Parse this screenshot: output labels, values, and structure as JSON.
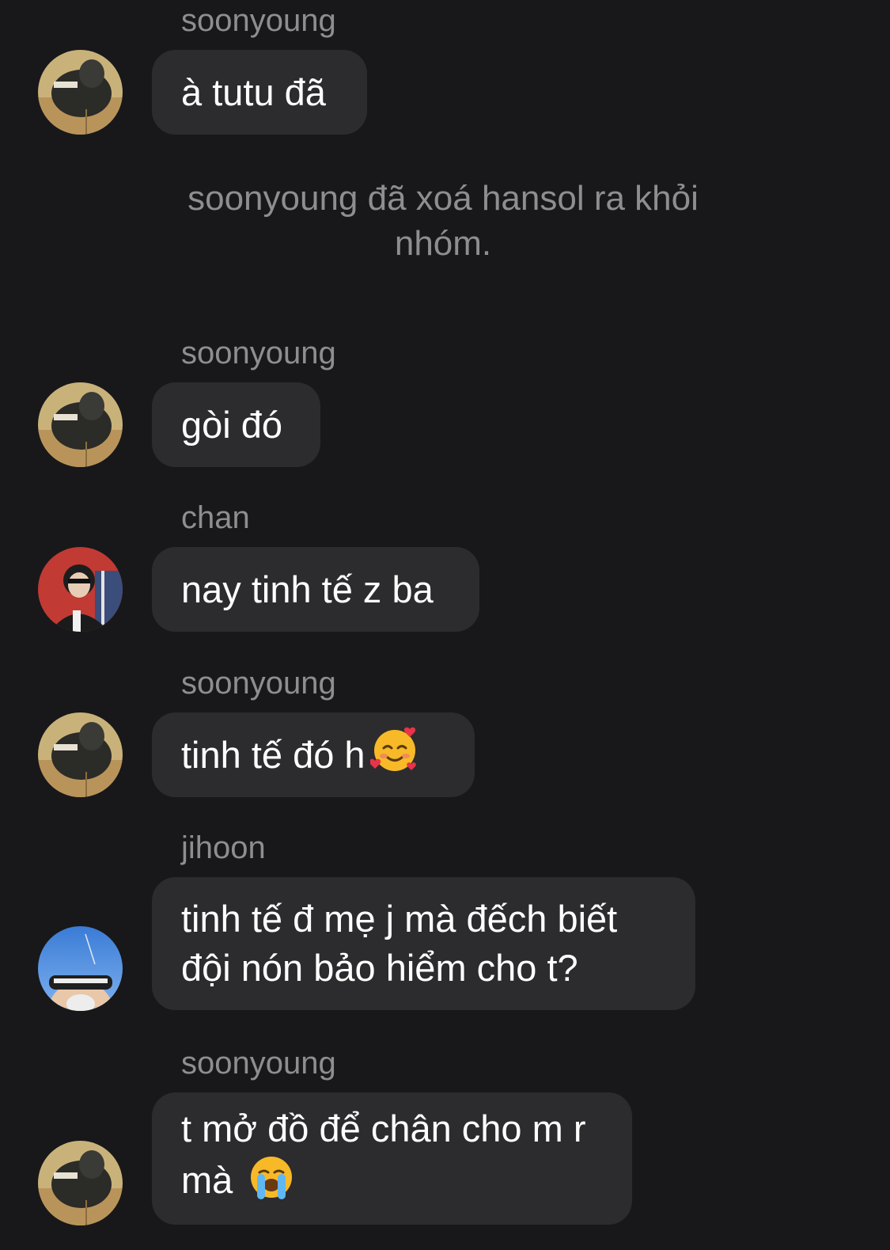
{
  "messages": [
    {
      "sender": "soonyoung",
      "text": "à tutu đã"
    },
    {
      "system": "soonyoung đã xoá hansol ra khỏi nhóm."
    },
    {
      "sender": "soonyoung",
      "text": "gòi đó"
    },
    {
      "sender": "chan",
      "text": "nay tinh tế z ba"
    },
    {
      "sender": "soonyoung",
      "text": "tinh tế đó h",
      "emoji": "smiling-face-with-hearts-icon"
    },
    {
      "sender": "jihoon",
      "text": "tinh tế đ mẹ j mà đếch biết đội nón bảo hiểm cho t?"
    },
    {
      "sender": "soonyoung",
      "text": "t mở đồ để chân cho m r mà",
      "emoji": "loudly-crying-face-icon"
    }
  ],
  "colors": {
    "background": "#18181a",
    "bubble": "#2c2c2e",
    "bubble_text": "#ffffff",
    "secondary_text": "#8d8d92"
  }
}
